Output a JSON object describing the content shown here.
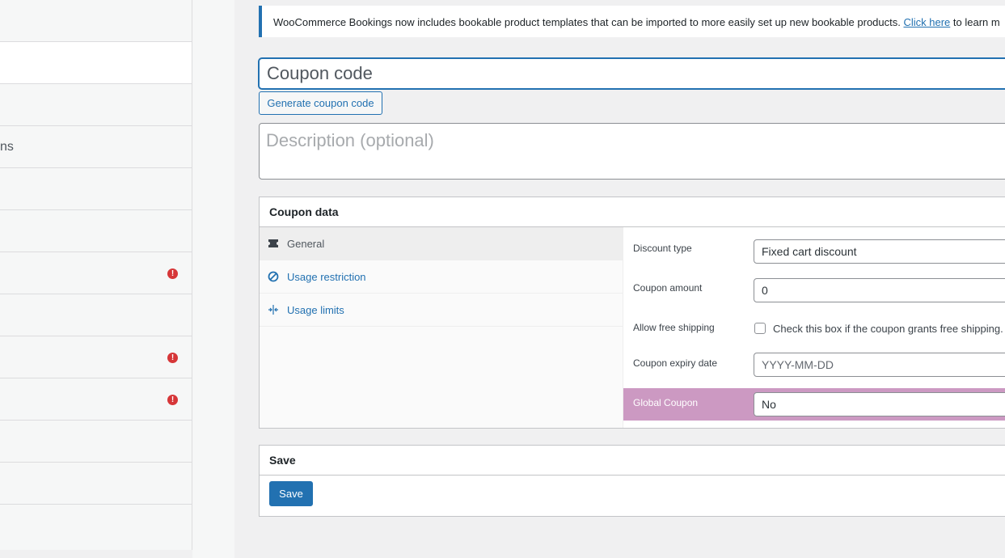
{
  "sidebar": {
    "rows": [
      {
        "text": ""
      },
      {
        "text": ""
      },
      {
        "text": ""
      },
      {
        "text": "ns"
      },
      {
        "text": ""
      },
      {
        "text": ""
      },
      {
        "text": "",
        "alert": "!"
      },
      {
        "text": ""
      },
      {
        "text": "",
        "alert": "!"
      },
      {
        "text": "",
        "alert": "!"
      },
      {
        "text": ""
      },
      {
        "text": ""
      },
      {
        "text": ""
      }
    ]
  },
  "notice": {
    "text": "WooCommerce Bookings now includes bookable product templates that can be imported to more easily set up new bookable products.",
    "link": "Click here",
    "after": "to learn m"
  },
  "coupon": {
    "code_placeholder": "Coupon code",
    "generate_label": "Generate coupon code",
    "description_placeholder": "Description (optional)"
  },
  "coupon_data": {
    "title": "Coupon data",
    "tabs": [
      "General",
      "Usage restriction",
      "Usage limits"
    ],
    "fields": {
      "discount_type_label": "Discount type",
      "discount_type_value": "Fixed cart discount",
      "amount_label": "Coupon amount",
      "amount_value": "0",
      "free_shipping_label": "Allow free shipping",
      "free_shipping_text": "Check this box if the coupon grants free shipping.",
      "expiry_label": "Coupon expiry date",
      "expiry_placeholder": "YYYY-MM-DD",
      "global_label": "Global Coupon",
      "global_value": "No"
    }
  },
  "save_box": {
    "title": "Save",
    "button": "Save"
  },
  "colors": {
    "accent": "#2271b1",
    "alert": "#d63638",
    "global_row": "#cc99c2"
  }
}
